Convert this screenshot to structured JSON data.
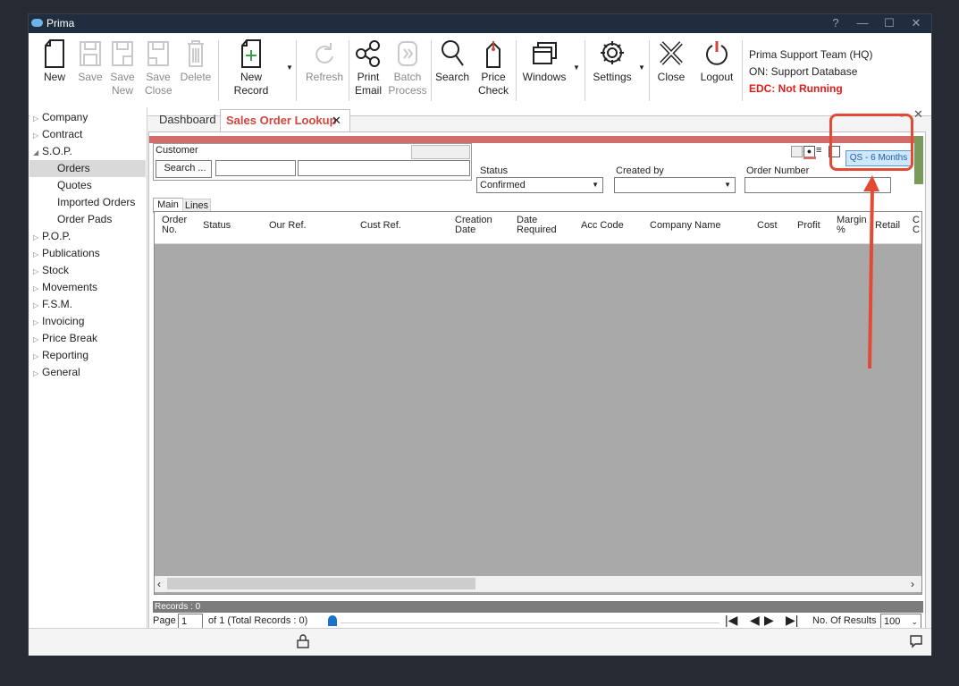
{
  "window": {
    "title": "Prima",
    "controls": [
      "?",
      "—",
      "☐",
      "✕"
    ]
  },
  "ribbon": {
    "new": "New",
    "save": "Save",
    "save_new_1": "Save",
    "save_new_2": "New",
    "save_close_1": "Save",
    "save_close_2": "Close",
    "delete": "Delete",
    "new_record": "New Record",
    "refresh": "Refresh",
    "print_email_1": "Print",
    "print_email_2": "Email",
    "batch_process_1": "Batch",
    "batch_process_2": "Process",
    "search": "Search",
    "price_check_1": "Price",
    "price_check_2": "Check",
    "windows": "Windows",
    "settings": "Settings",
    "close": "Close",
    "logout": "Logout"
  },
  "user": {
    "team": "Prima Support Team (HQ)",
    "database": "ON: Support Database",
    "edc": "EDC: Not Running"
  },
  "nav": [
    {
      "label": "Company",
      "state": "collapsed"
    },
    {
      "label": "Contract",
      "state": "collapsed"
    },
    {
      "label": "S.O.P.",
      "state": "expanded"
    },
    {
      "label": "Orders",
      "child": true,
      "selected": true
    },
    {
      "label": "Quotes",
      "child": true
    },
    {
      "label": "Imported Orders",
      "child": true
    },
    {
      "label": "Order Pads",
      "child": true
    },
    {
      "label": "P.O.P.",
      "state": "collapsed"
    },
    {
      "label": "Publications",
      "state": "collapsed"
    },
    {
      "label": "Stock",
      "state": "collapsed"
    },
    {
      "label": "Movements",
      "state": "collapsed"
    },
    {
      "label": "F.S.M.",
      "state": "collapsed"
    },
    {
      "label": "Invoicing",
      "state": "collapsed"
    },
    {
      "label": "Price Break",
      "state": "collapsed"
    },
    {
      "label": "Reporting",
      "state": "collapsed"
    },
    {
      "label": "General",
      "state": "collapsed"
    }
  ],
  "tabs": {
    "dashboard": "Dashboard",
    "sales_order_lookup": "Sales Order Lookup",
    "close_glyph": "✕"
  },
  "filters": {
    "customer_label": "Customer",
    "search_button": "Search ...",
    "status_label": "Status",
    "status_value": "Confirmed",
    "created_by_label": "Created by",
    "created_by_value": "",
    "order_number_label": "Order Number",
    "order_number_value": "",
    "qs_button": "QS - 6 Months"
  },
  "subtabs": {
    "main": "Main",
    "lines": "Lines"
  },
  "grid": {
    "columns": [
      [
        "Order",
        "No."
      ],
      [
        "Status",
        ""
      ],
      [
        "Our Ref.",
        ""
      ],
      [
        "Cust Ref.",
        ""
      ],
      [
        "Creation",
        "Date"
      ],
      [
        "Date",
        "Required"
      ],
      [
        "Acc Code",
        ""
      ],
      [
        "Company Name",
        ""
      ],
      [
        "Cost",
        ""
      ],
      [
        "Profit",
        ""
      ],
      [
        "Margin",
        "%"
      ],
      [
        "Retail",
        ""
      ],
      [
        "C",
        "C"
      ]
    ]
  },
  "footer": {
    "records": "Records : 0",
    "page_label": "Page",
    "page_value": "1",
    "of_total": "of  1  (Total Records : 0)",
    "results_label": "No. Of Results",
    "results_value": "100"
  },
  "colors": {
    "titlebar": "#1f2d3e",
    "accent_tab": "#d0463c",
    "edc": "#e21b1b",
    "annotation": "#e24a35",
    "filter_bar": "#d26d6d"
  }
}
